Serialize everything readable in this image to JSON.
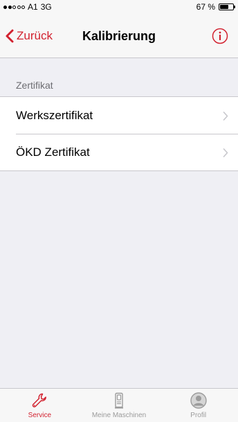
{
  "status_bar": {
    "carrier": "A1",
    "network": "3G",
    "battery_percent": "67 %",
    "battery_level": 0.67,
    "signal_bars_filled": 2,
    "signal_bars_total": 5
  },
  "nav": {
    "back_label": "Zurück",
    "title": "Kalibrierung",
    "info_icon": "info-circle-icon"
  },
  "section": {
    "header": "Zertifikat"
  },
  "list": {
    "items": [
      {
        "label": "Werkszertifikat"
      },
      {
        "label": "ÖKD Zertifikat"
      }
    ]
  },
  "tab_bar": {
    "items": [
      {
        "label": "Service",
        "icon": "wrench-icon",
        "active": true
      },
      {
        "label": "Meine Maschinen",
        "icon": "machine-icon",
        "active": false
      },
      {
        "label": "Profil",
        "icon": "profile-icon",
        "active": false
      }
    ]
  },
  "colors": {
    "accent": "#d2212f",
    "inactive": "#9b9b9b",
    "background": "#efeff4"
  }
}
